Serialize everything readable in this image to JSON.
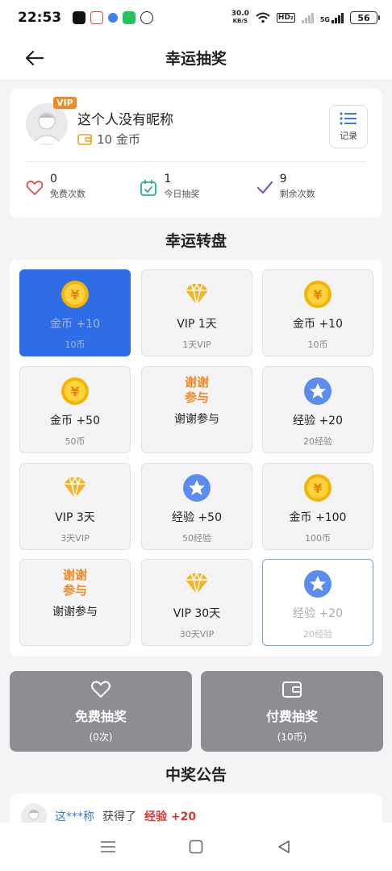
{
  "status_bar": {
    "time": "22:53",
    "net_speed_value": "30.0",
    "net_speed_unit": "KB/S",
    "hd_label": "HD₂",
    "network_type": "5G",
    "battery": "56"
  },
  "header": {
    "title": "幸运抽奖"
  },
  "user": {
    "vip_badge": "VIP",
    "nickname": "这个人没有昵称",
    "coins": "10 金币",
    "record_label": "记录"
  },
  "stats": [
    {
      "value": "0",
      "label": "免费次数",
      "icon": "heart-icon",
      "color": "#d9534f"
    },
    {
      "value": "1",
      "label": "今日抽奖",
      "icon": "calendar-check-icon",
      "color": "#22b38a"
    },
    {
      "value": "9",
      "label": "剩余次数",
      "icon": "checkmark-icon",
      "color": "#7e57c2"
    }
  ],
  "wheel": {
    "title": "幸运转盘",
    "prizes": [
      {
        "title": "金币 +10",
        "sub": "10币",
        "icon": "coin-icon",
        "state": "active"
      },
      {
        "title": "VIP 1天",
        "sub": "1天VIP",
        "icon": "diamond-icon",
        "state": "normal"
      },
      {
        "title": "金币 +10",
        "sub": "10币",
        "icon": "coin-icon",
        "state": "normal"
      },
      {
        "title": "金币 +50",
        "sub": "50币",
        "icon": "coin-icon",
        "state": "normal"
      },
      {
        "title": "谢谢参与",
        "sub": "",
        "icon": "thanks-icon",
        "icon_text_1": "谢谢",
        "icon_text_2": "参与",
        "state": "normal"
      },
      {
        "title": "经验 +20",
        "sub": "20经验",
        "icon": "star-icon",
        "state": "normal"
      },
      {
        "title": "VIP 3天",
        "sub": "3天VIP",
        "icon": "diamond-icon",
        "state": "normal"
      },
      {
        "title": "经验 +50",
        "sub": "50经验",
        "icon": "star-icon",
        "state": "normal"
      },
      {
        "title": "金币 +100",
        "sub": "100币",
        "icon": "coin-icon",
        "state": "normal"
      },
      {
        "title": "谢谢参与",
        "sub": "",
        "icon": "thanks-icon",
        "icon_text_1": "谢谢",
        "icon_text_2": "参与",
        "state": "normal"
      },
      {
        "title": "VIP 30天",
        "sub": "30天VIP",
        "icon": "diamond-icon",
        "state": "normal"
      },
      {
        "title": "经验 +20",
        "sub": "20经验",
        "icon": "star-icon",
        "state": "selected"
      }
    ]
  },
  "buttons": {
    "free": {
      "title": "免费抽奖",
      "sub": "(0次)"
    },
    "paid": {
      "title": "付费抽奖",
      "sub": "(10币)"
    }
  },
  "announcement": {
    "title": "中奖公告",
    "items": [
      {
        "name": "这***称",
        "verb": "获得了",
        "prize": "经验 +20"
      }
    ]
  },
  "colors": {
    "accent_blue": "#2f6de7",
    "coin_gold": "#f5b400",
    "vip_orange": "#f08a24",
    "star_blue": "#5b8def",
    "button_gray": "#8d8d93"
  }
}
